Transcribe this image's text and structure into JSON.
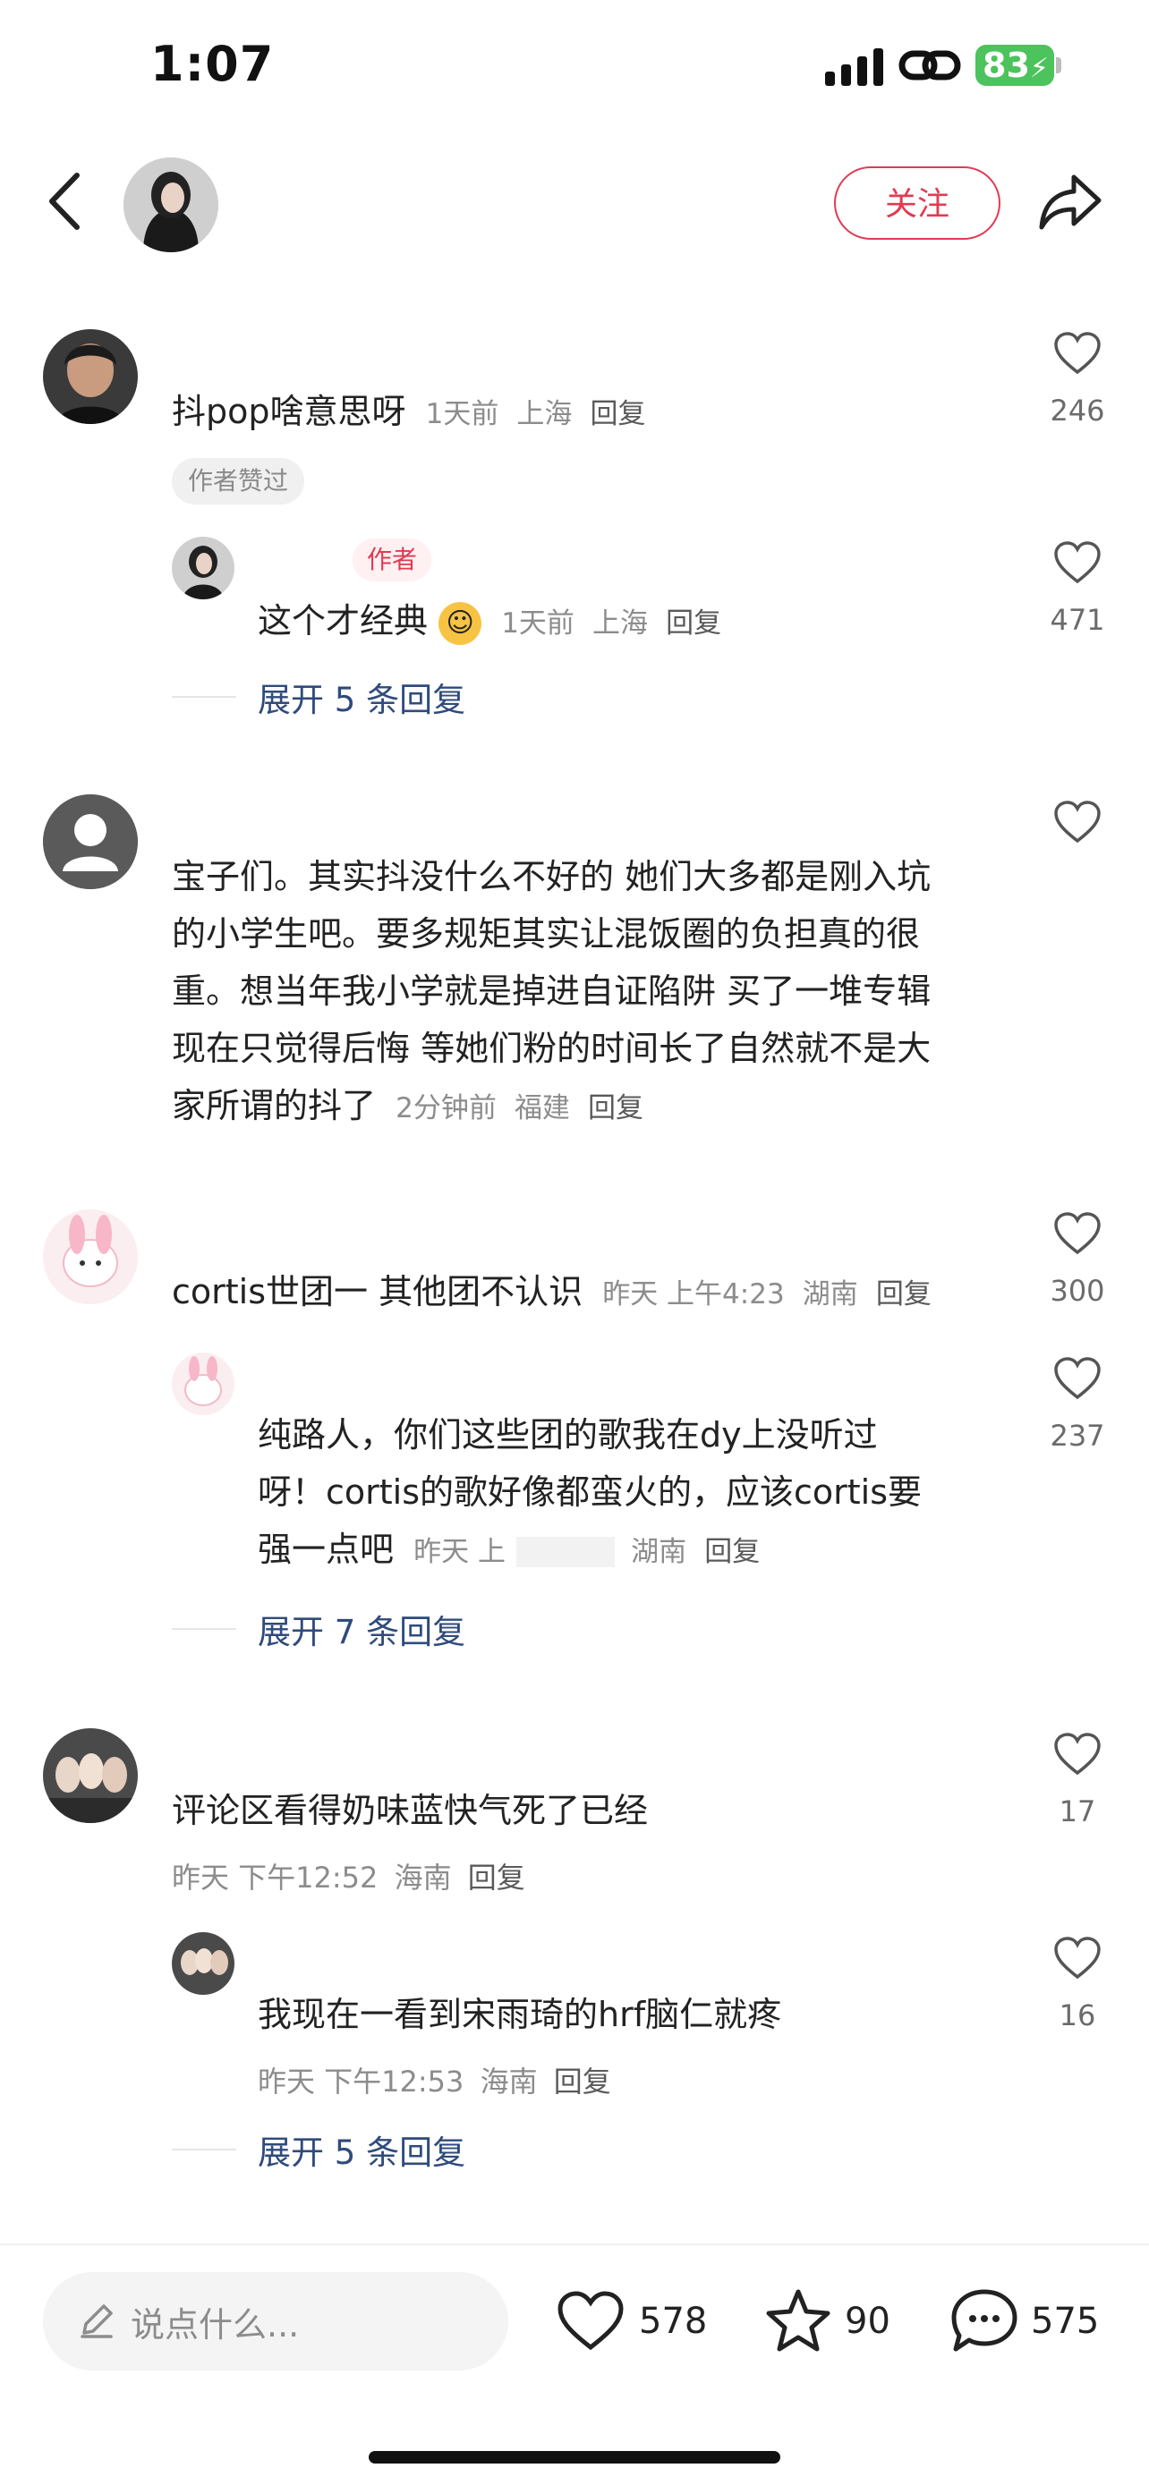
{
  "status_bar": {
    "time": "1:07",
    "battery": "83"
  },
  "header": {
    "follow_label": "关注"
  },
  "comments": [
    {
      "text": "抖pop啥意思呀",
      "time": "1天前",
      "location": "上海",
      "reply": "回复",
      "tag": "作者赞过",
      "likes": "246",
      "replies": [
        {
          "tag": "作者",
          "text": "这个才经典",
          "time": "1天前",
          "location": "上海",
          "reply": "回复",
          "likes": "471"
        }
      ],
      "expand": "展开 5 条回复"
    },
    {
      "lines": [
        "宝子们。其实抖没什么不好的 她们大多都是刚入坑",
        "的小学生吧。要多规矩其实让混饭圈的负担真的很",
        "重。想当年我小学就是掉进自证陷阱 买了一堆专辑",
        "现在只觉得后悔 等她们粉的时间长了自然就不是大",
        "家所谓的抖了"
      ],
      "time": "2分钟前",
      "location": "福建",
      "reply": "回复"
    },
    {
      "text": "cortis世团一 其他团不认识",
      "time": "昨天 上午4:23",
      "location": "湖南",
      "reply": "回复",
      "likes": "300",
      "replies": [
        {
          "lines": [
            "纯路人，你们这些团的歌我在dy上没听过",
            "呀！cortis的歌好像都蛮火的，应该cortis要",
            "强一点吧"
          ],
          "time": "昨天 上",
          "location": "湖南",
          "reply": "回复",
          "likes": "237"
        }
      ],
      "expand": "展开 7 条回复"
    },
    {
      "text": "评论区看得奶味蓝快气死了已经",
      "time": "昨天 下午12:52",
      "location": "海南",
      "reply": "回复",
      "likes": "17",
      "replies": [
        {
          "text": "我现在一看到宋雨琦的hrf脑仁就疼",
          "time": "昨天 下午12:53",
          "location": "海南",
          "reply": "回复",
          "likes": "16"
        }
      ],
      "expand": "展开 5 条回复"
    }
  ],
  "bottom_bar": {
    "placeholder": "说点什么...",
    "likes": "578",
    "stars": "90",
    "comments": "575"
  }
}
